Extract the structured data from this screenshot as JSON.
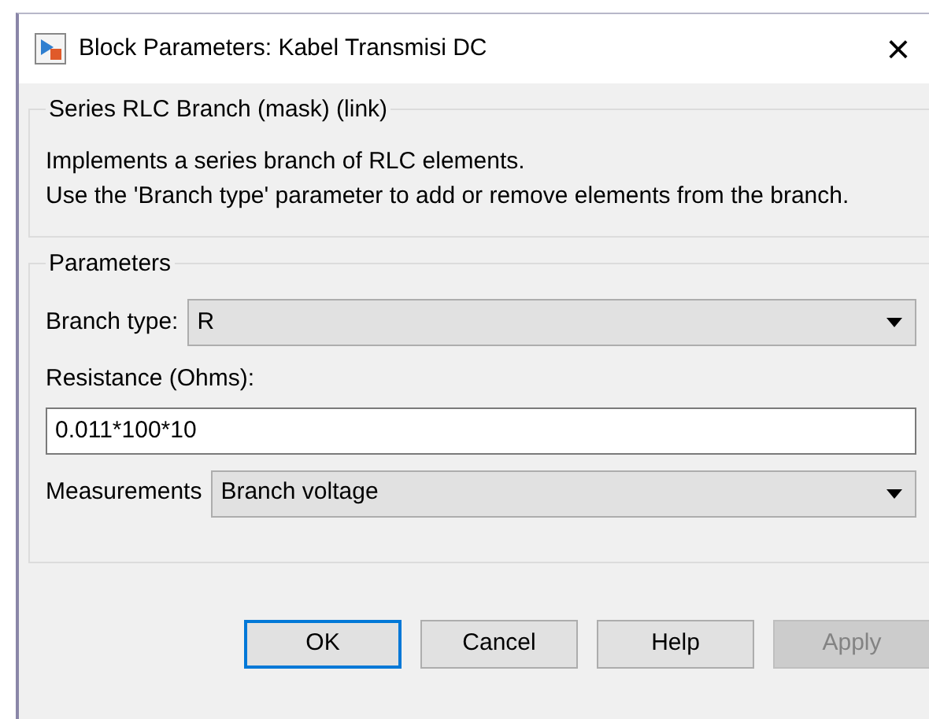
{
  "window": {
    "title": "Block Parameters: Kabel Transmisi DC",
    "close": "×"
  },
  "description": {
    "title": "Series RLC Branch (mask) (link)",
    "lines": [
      "Implements a series branch of RLC elements.",
      "Use the 'Branch type' parameter to add or remove elements from the branch."
    ]
  },
  "parameters": {
    "title": "Parameters",
    "fields": [
      {
        "kind": "dropdown",
        "label": "Branch type:",
        "value": "R"
      },
      {
        "kind": "text",
        "label": "Resistance (Ohms):",
        "value": "0.011*100*10"
      },
      {
        "kind": "dropdown",
        "label": "Measurements",
        "value": "Branch voltage"
      }
    ]
  },
  "buttons": [
    {
      "label": "OK",
      "focused": true,
      "disabled": false
    },
    {
      "label": "Cancel",
      "focused": false,
      "disabled": false
    },
    {
      "label": "Help",
      "focused": false,
      "disabled": false
    },
    {
      "label": "Apply",
      "focused": false,
      "disabled": true
    }
  ]
}
